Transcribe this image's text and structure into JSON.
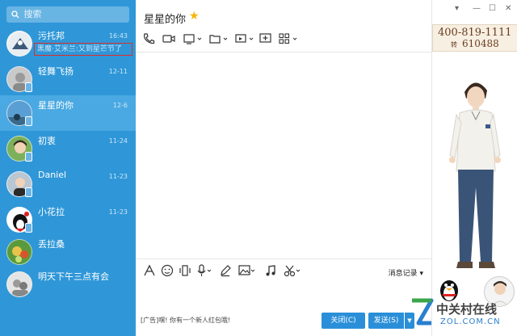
{
  "sidebar": {
    "search_placeholder": "搜索",
    "contacts": [
      {
        "name": "污托邦",
        "time": "16:43",
        "preview": "黑魔·艾米兰:又到星芒节了"
      },
      {
        "name": "轻舞飞扬",
        "time": "12-11"
      },
      {
        "name": "星星的你",
        "time": "12-6"
      },
      {
        "name": "初衷",
        "time": "11-24"
      },
      {
        "name": "Daniel",
        "time": "11-23"
      },
      {
        "name": "小花拉",
        "time": "11-23"
      },
      {
        "name": "丢拉桑",
        "time": ""
      },
      {
        "name": "明天下午三点有会",
        "time": ""
      }
    ]
  },
  "chat": {
    "title": "星星的你",
    "history_label": "消息记录 ▾",
    "ad_text": "[广告]嘿! 你有一个新人红包哦!",
    "close_label": "关闭(C)",
    "send_label": "发送(S)",
    "send_arrow": "▼"
  },
  "right_panel": {
    "phone_main": "400-819-1111",
    "phone_ext_label": "转",
    "phone_ext": "610488"
  },
  "watermark": {
    "main": "中关村在线",
    "sub": "ZOL.COM.CN"
  },
  "colors": {
    "sidebar_bg": "#2f97d8",
    "active_bg": "#4aa9e2",
    "button_blue": "#2a8fd8",
    "highlight_border": "#d9302b"
  }
}
